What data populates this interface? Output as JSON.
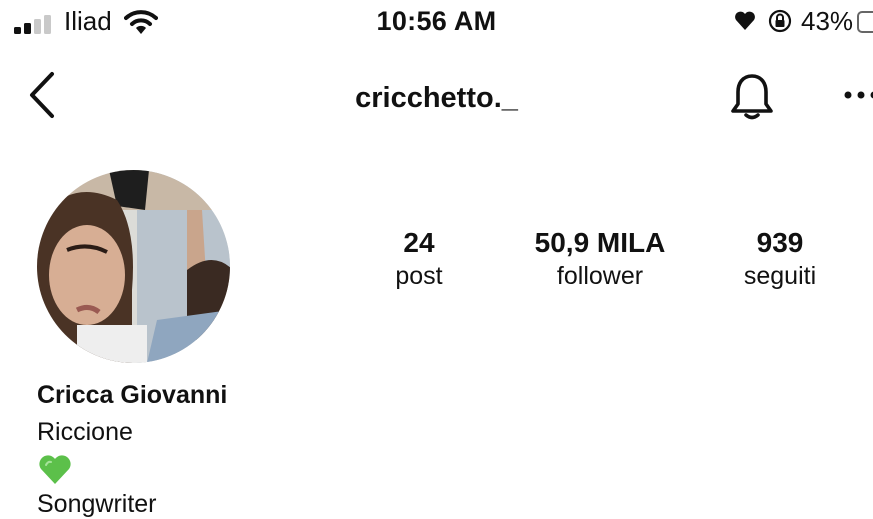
{
  "status_bar": {
    "carrier": "Iliad",
    "time": "10:56 AM",
    "battery": "43%",
    "signal_bars_filled": 2,
    "signal_bars_total": 4
  },
  "header": {
    "username": "cricchetto._",
    "icons": [
      "back-arrow-icon",
      "bell-icon",
      "more-icon"
    ]
  },
  "profile": {
    "stats": [
      {
        "value": "24",
        "label": "post"
      },
      {
        "value": "50,9 MILA",
        "label": "follower"
      },
      {
        "value": "939",
        "label": "seguiti"
      }
    ],
    "name": "Cricca Giovanni",
    "location": "Riccione",
    "bio": "Songwriter",
    "emoji": "green-heart-icon"
  },
  "colors": {
    "text": "#111111",
    "background": "#ffffff",
    "heart_green": "#5cc04a"
  }
}
